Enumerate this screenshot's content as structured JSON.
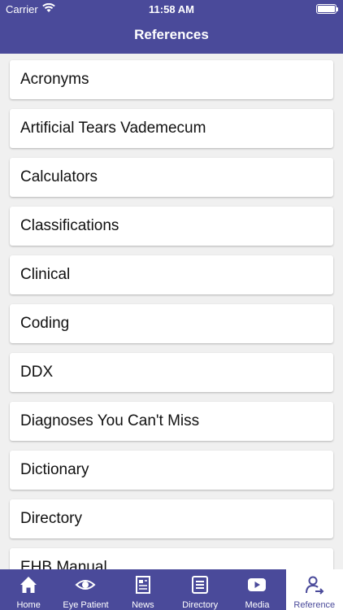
{
  "status": {
    "carrier": "Carrier",
    "time": "11:58 AM"
  },
  "header": {
    "title": "References"
  },
  "list": {
    "items": [
      "Acronyms",
      "Artificial Tears Vademecum",
      "Calculators",
      "Classifications",
      "Clinical",
      "Coding",
      "DDX",
      "Diagnoses You Can't Miss",
      "Dictionary",
      "Directory",
      "EHB Manual"
    ]
  },
  "tabbar": {
    "tabs": [
      {
        "label": "Home",
        "icon": "home-icon"
      },
      {
        "label": "Eye Patient",
        "icon": "eye-icon"
      },
      {
        "label": "News",
        "icon": "newspaper-icon"
      },
      {
        "label": "Directory",
        "icon": "list-icon"
      },
      {
        "label": "Media",
        "icon": "play-icon"
      },
      {
        "label": "Reference",
        "icon": "user-arrow-icon"
      }
    ],
    "active": "Reference"
  },
  "colors": {
    "brand": "#4a4a9a",
    "background": "#f0f0f0",
    "card": "#ffffff"
  }
}
